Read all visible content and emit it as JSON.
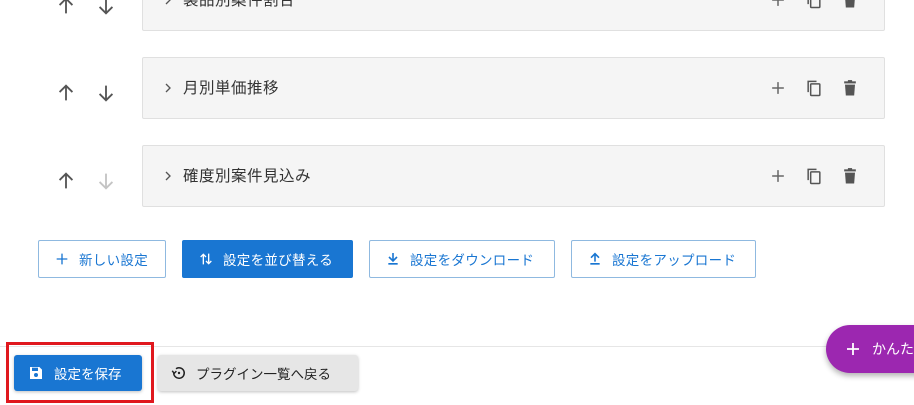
{
  "settings_list": {
    "items": [
      {
        "label": "製品別案件割合",
        "down_enabled": true
      },
      {
        "label": "月別単価推移",
        "down_enabled": true
      },
      {
        "label": "確度別案件見込み",
        "down_enabled": false
      }
    ]
  },
  "toolbar": {
    "new_label": "新しい設定",
    "sort_label": "設定を並び替える",
    "download_label": "設定をダウンロード",
    "upload_label": "設定をアップロード"
  },
  "footer": {
    "save_label": "設定を保存",
    "back_label": "プラグイン一覧へ戻る"
  },
  "fab": {
    "label": "かんたん"
  },
  "colors": {
    "primary": "#1976d2",
    "fab": "#9c27b0",
    "highlight": "#e0181e",
    "panel_bg": "#f5f5f5"
  }
}
